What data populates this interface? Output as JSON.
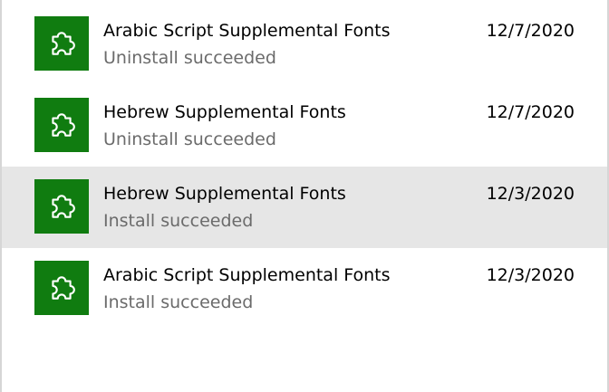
{
  "history": {
    "items": [
      {
        "title": "Arabic Script Supplemental Fonts",
        "status": "Uninstall succeeded",
        "date": "12/7/2020",
        "icon": "puzzle-piece-icon",
        "selected": false
      },
      {
        "title": "Hebrew Supplemental Fonts",
        "status": "Uninstall succeeded",
        "date": "12/7/2020",
        "icon": "puzzle-piece-icon",
        "selected": false
      },
      {
        "title": "Hebrew Supplemental Fonts",
        "status": "Install succeeded",
        "date": "12/3/2020",
        "icon": "puzzle-piece-icon",
        "selected": true
      },
      {
        "title": "Arabic Script Supplemental Fonts",
        "status": "Install succeeded",
        "date": "12/3/2020",
        "icon": "puzzle-piece-icon",
        "selected": false
      }
    ]
  },
  "colors": {
    "tile": "#107c10",
    "selected_row": "#e6e6e6",
    "secondary_text": "#6b6b6b"
  }
}
